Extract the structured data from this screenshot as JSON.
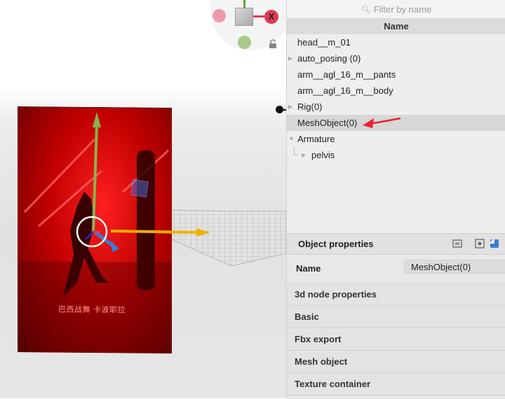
{
  "viewport": {
    "gizmo": {
      "x_axis_label": "X"
    },
    "image_text": "巴西战舞 卡波耶拉",
    "lock_icon": "lock-icon"
  },
  "outliner": {
    "filter_placeholder": "Filter by name",
    "column_header": "Name",
    "items": [
      {
        "label": "head__m_01",
        "expandable": false,
        "selected": false
      },
      {
        "label": "auto_posing (0)",
        "expandable": true,
        "selected": false
      },
      {
        "label": "arm__agl_16_m__pants",
        "expandable": false,
        "selected": false
      },
      {
        "label": "arm__agl_16_m__body",
        "expandable": false,
        "selected": false
      },
      {
        "label": "Rig(0)",
        "expandable": true,
        "selected": false
      },
      {
        "label": "MeshObject(0)",
        "expandable": false,
        "selected": true
      },
      {
        "label": "Armature",
        "expandable": true,
        "expanded": true,
        "selected": false
      },
      {
        "label": "pelvis",
        "expandable": true,
        "selected": false,
        "child": true
      }
    ]
  },
  "properties": {
    "title": "Object properties",
    "name_label": "Name",
    "name_value": "MeshObject(0)",
    "sections": [
      "3d node  properties",
      "Basic",
      "Fbx export",
      "Mesh object",
      "Texture container"
    ]
  },
  "colors": {
    "annotation_arrow": "#e8222e",
    "gizmo_x": "#e03a55",
    "gizmo_y": "#8ab34a",
    "gizmo_z": "#3a57d8",
    "move_x": "#f0b000"
  }
}
